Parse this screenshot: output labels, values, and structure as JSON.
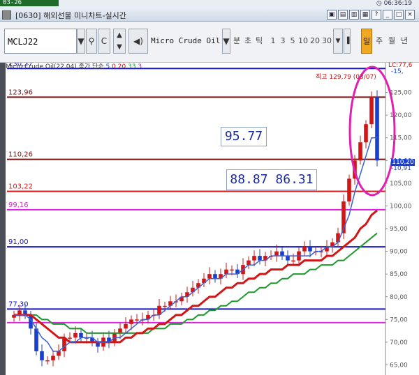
{
  "header": {
    "clock": "06:36:19",
    "window_title": "[0630] 해외선물 미니차트-실시간"
  },
  "toolbar": {
    "symbol": "MCLJ22",
    "product_name": "Micro Crude Oil",
    "periods": [
      "분",
      "초",
      "틱",
      "1",
      "3",
      "5",
      "10",
      "20",
      "30",
      "일",
      "주",
      "월",
      "년"
    ],
    "active_period": "일"
  },
  "chart": {
    "legend": {
      "title": "Micro Crude Oil(22,04)",
      "ma_label": "종가 단순",
      "ma5": "5",
      "ma0": "0",
      "ma20": "20",
      "ma33": "33",
      "ma3": "3"
    },
    "high_label": "최고 129,79 (03/07)",
    "current_price": "110,20",
    "change_top": "LC:77,6",
    "change_top2": "-15,",
    "change_mid": "-10,91",
    "annotation_1": "95.77",
    "annotation_2": "88.87 86.31",
    "colors": {
      "up": "#d41515",
      "down": "#1a3fcf",
      "ma_blue": "#3a60d8",
      "ma_red": "#d41515",
      "ma_green": "#1b9a2b",
      "line_darkred": "#7a1010",
      "line_blue": "#1515c8",
      "line_red": "#e01818",
      "line_magenta": "#e020e0",
      "highlight_circle": "#e020b0"
    }
  },
  "chart_data": {
    "type": "candlestick",
    "title": "Micro Crude Oil(22,04)",
    "ylim": [
      64,
      130
    ],
    "y_ticks": [
      "125,00",
      "120,00",
      "115,00",
      "110,00",
      "105,00",
      "100,00",
      "95,00",
      "90,00",
      "85,00",
      "80,00",
      "75,00",
      "70,00",
      "65,00"
    ],
    "levels": [
      {
        "label": "123,96",
        "value": 123.96,
        "color": "#7a1010"
      },
      {
        "label": "110,26",
        "value": 110.26,
        "color": "#7a1010"
      },
      {
        "label": "103,22",
        "value": 103.22,
        "color": "#e01818"
      },
      {
        "label": "99,16",
        "value": 99.16,
        "color": "#e020e0"
      },
      {
        "label": "91,00",
        "value": 91.0,
        "color": "#1515c8"
      },
      {
        "label": "77,30",
        "value": 77.3,
        "color": "#1515c8"
      },
      {
        "label": "",
        "value": 74.3,
        "color": "#e020e0"
      },
      {
        "label": "130,27",
        "value": 130.27,
        "color": "#1515c8"
      }
    ],
    "close_series": [
      76,
      77,
      76,
      73,
      68,
      66,
      66,
      67,
      68,
      71,
      71,
      72,
      71,
      71,
      70,
      69,
      71,
      70,
      72,
      73,
      74,
      75,
      75,
      75,
      76,
      76,
      78,
      78,
      79,
      79,
      80,
      81,
      82,
      83,
      84,
      85,
      84,
      85,
      86,
      86,
      85,
      87,
      88,
      89,
      88,
      89,
      89,
      90,
      89,
      88,
      88,
      90,
      91,
      90,
      90,
      90,
      91,
      92,
      94,
      101,
      106,
      110,
      114,
      118,
      124,
      110
    ],
    "ma5": [
      76,
      76,
      76,
      75,
      73,
      71,
      70,
      68,
      68,
      69,
      70,
      70,
      71,
      71,
      71,
      70,
      70,
      70,
      71,
      71,
      72,
      73,
      74,
      75,
      75,
      76,
      76,
      77,
      78,
      79,
      80,
      80,
      81,
      82,
      83,
      84,
      84,
      84,
      85,
      85,
      85,
      86,
      87,
      87,
      88,
      88,
      89,
      89,
      89,
      89,
      89,
      89,
      89,
      89,
      90,
      90,
      91,
      91,
      92,
      95,
      98,
      103,
      107,
      111,
      115,
      115
    ],
    "ma20": [
      76,
      76,
      76,
      76,
      75,
      74,
      73,
      72,
      71,
      71,
      70,
      70,
      70,
      70,
      70,
      70,
      70,
      70,
      70,
      70,
      71,
      71,
      72,
      72,
      73,
      73,
      74,
      74,
      75,
      76,
      76,
      77,
      78,
      78,
      79,
      80,
      80,
      81,
      82,
      82,
      83,
      83,
      84,
      84,
      85,
      85,
      86,
      86,
      86,
      87,
      87,
      87,
      88,
      88,
      88,
      88,
      89,
      89,
      90,
      91,
      92,
      93,
      95,
      96,
      98,
      99
    ],
    "ma33": [
      76,
      76,
      76,
      76,
      76,
      75,
      75,
      74,
      74,
      74,
      73,
      73,
      73,
      72,
      72,
      72,
      72,
      72,
      72,
      72,
      72,
      72,
      72,
      72,
      72,
      73,
      73,
      73,
      74,
      74,
      74,
      75,
      75,
      76,
      76,
      77,
      77,
      78,
      78,
      79,
      79,
      80,
      81,
      81,
      82,
      82,
      83,
      83,
      84,
      84,
      85,
      85,
      85,
      86,
      86,
      87,
      87,
      87,
      88,
      88,
      89,
      90,
      91,
      92,
      93,
      94
    ]
  }
}
